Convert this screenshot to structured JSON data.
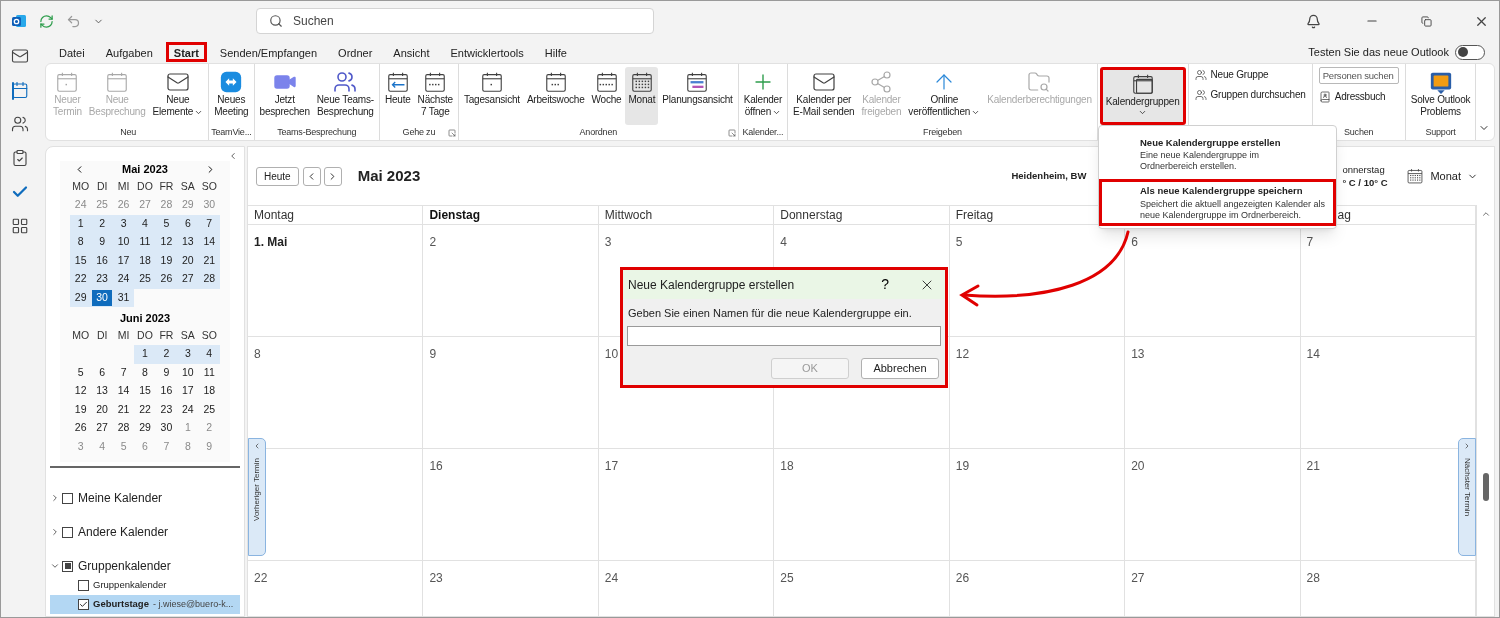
{
  "title_bar": {
    "search": {
      "placeholder": "Suchen"
    }
  },
  "rail": {
    "items": [
      {
        "selected": false
      },
      {
        "selected": true
      },
      {
        "selected": false
      },
      {
        "selected": false
      },
      {
        "selected": false
      },
      {
        "selected": false
      }
    ]
  },
  "menu": {
    "tabs": [
      {
        "label": "Datei",
        "selected": false
      },
      {
        "label": "Aufgaben",
        "selected": false
      },
      {
        "label": "Start",
        "selected": true,
        "highlighted": true
      },
      {
        "label": "Senden/Empfangen",
        "selected": false
      },
      {
        "label": "Ordner",
        "selected": false
      },
      {
        "label": "Ansicht",
        "selected": false
      },
      {
        "label": "Entwicklertools",
        "selected": false
      },
      {
        "label": "Hilfe",
        "selected": false
      }
    ],
    "toggle": {
      "label": "Testen Sie das neue Outlook",
      "on": false
    }
  },
  "ribbon": {
    "groups": [
      {
        "label": "Neu",
        "buttons": [
          {
            "kind": "large",
            "lines": [
              "Neuer",
              "Termin"
            ],
            "disabled": true
          },
          {
            "kind": "large",
            "lines": [
              "Neue",
              "Besprechung"
            ],
            "disabled": true
          },
          {
            "kind": "large",
            "lines": [
              "Neue",
              "Elemente"
            ],
            "caret": true
          }
        ]
      },
      {
        "label": "TeamVie...",
        "buttons": [
          {
            "kind": "large",
            "lines": [
              "Neues",
              "Meeting"
            ]
          }
        ]
      },
      {
        "label": "Teams-Besprechung",
        "buttons": [
          {
            "kind": "large",
            "lines": [
              "Jetzt",
              "besprechen"
            ]
          },
          {
            "kind": "large",
            "lines": [
              "Neue Teams-",
              "Besprechung"
            ]
          }
        ]
      },
      {
        "label": "Gehe zu",
        "launcher": true,
        "buttons": [
          {
            "kind": "large",
            "lines": [
              "Heute"
            ]
          },
          {
            "kind": "large",
            "lines": [
              "Nächste",
              "7 Tage"
            ]
          }
        ]
      },
      {
        "label": "Anordnen",
        "launcher": true,
        "buttons": [
          {
            "kind": "large",
            "lines": [
              "Tagesansicht"
            ],
            "selected": false
          },
          {
            "kind": "large",
            "lines": [
              "Arbeitswoche"
            ],
            "selected": false
          },
          {
            "kind": "large",
            "lines": [
              "Woche"
            ],
            "selected": false
          },
          {
            "kind": "large",
            "lines": [
              "Monat"
            ],
            "selected": true
          },
          {
            "kind": "large",
            "lines": [
              "Planungsansicht"
            ],
            "selected": false
          }
        ]
      },
      {
        "label": "Kalender...",
        "buttons": [
          {
            "kind": "large",
            "lines": [
              "Kalender",
              "öffnen"
            ],
            "caret": true
          }
        ]
      },
      {
        "label": "Freigeben",
        "buttons": [
          {
            "kind": "large",
            "lines": [
              "Kalender per",
              "E-Mail senden"
            ]
          },
          {
            "kind": "large",
            "lines": [
              "Kalender",
              "freigeben"
            ],
            "disabled": true
          },
          {
            "kind": "large",
            "lines": [
              "Online",
              "veröffentlichen"
            ],
            "caret": true
          },
          {
            "kind": "large",
            "lines": [
              "Kalenderberechtigungen"
            ],
            "disabled": true
          }
        ]
      },
      {
        "buttons": [
          {
            "kind": "large",
            "lines": [
              "Kalendergruppen"
            ],
            "selected": true,
            "caret": true,
            "highlighted": true
          }
        ]
      },
      {
        "buttons": [
          {
            "kind": "small",
            "lines": [
              "Neue Gruppe"
            ]
          },
          {
            "kind": "small",
            "lines": [
              "Gruppen durchsuchen"
            ]
          }
        ]
      },
      {
        "label": "Suchen",
        "buttons": [
          {
            "kind": "field",
            "placeholder": "Personen suchen"
          },
          {
            "kind": "small",
            "lines": [
              "Adressbuch"
            ]
          }
        ]
      },
      {
        "label": "Support",
        "buttons": [
          {
            "kind": "large",
            "lines": [
              "Solve Outlook",
              "Problems"
            ]
          }
        ]
      }
    ]
  },
  "sidebar": {
    "months": [
      {
        "title": "Mai 2023",
        "weekdays": [
          "MO",
          "DI",
          "MI",
          "DO",
          "FR",
          "SA",
          "SO"
        ],
        "weeks": [
          [
            {
              "day": "24",
              "muted": true,
              "in_view": false,
              "selected": false
            },
            {
              "day": "25",
              "muted": true,
              "in_view": false,
              "selected": false
            },
            {
              "day": "26",
              "muted": true,
              "in_view": false,
              "selected": false
            },
            {
              "day": "27",
              "muted": true,
              "in_view": false,
              "selected": false
            },
            {
              "day": "28",
              "muted": true,
              "in_view": false,
              "selected": false
            },
            {
              "day": "29",
              "muted": true,
              "in_view": false,
              "selected": false
            },
            {
              "day": "30",
              "muted": true,
              "in_view": false,
              "selected": false
            }
          ],
          [
            {
              "day": "1",
              "muted": false,
              "in_view": true,
              "selected": false
            },
            {
              "day": "2",
              "muted": false,
              "in_view": true,
              "selected": false
            },
            {
              "day": "3",
              "muted": false,
              "in_view": true,
              "selected": false
            },
            {
              "day": "4",
              "muted": false,
              "in_view": true,
              "selected": false
            },
            {
              "day": "5",
              "muted": false,
              "in_view": true,
              "selected": false
            },
            {
              "day": "6",
              "muted": false,
              "in_view": true,
              "selected": false
            },
            {
              "day": "7",
              "muted": false,
              "in_view": true,
              "selected": false
            }
          ],
          [
            {
              "day": "8",
              "muted": false,
              "in_view": true,
              "selected": false
            },
            {
              "day": "9",
              "muted": false,
              "in_view": true,
              "selected": false
            },
            {
              "day": "10",
              "muted": false,
              "in_view": true,
              "selected": false
            },
            {
              "day": "11",
              "muted": false,
              "in_view": true,
              "selected": false
            },
            {
              "day": "12",
              "muted": false,
              "in_view": true,
              "selected": false
            },
            {
              "day": "13",
              "muted": false,
              "in_view": true,
              "selected": false
            },
            {
              "day": "14",
              "muted": false,
              "in_view": true,
              "selected": false
            }
          ],
          [
            {
              "day": "15",
              "muted": false,
              "in_view": true,
              "selected": false
            },
            {
              "day": "16",
              "muted": false,
              "in_view": true,
              "selected": false
            },
            {
              "day": "17",
              "muted": false,
              "in_view": true,
              "selected": false
            },
            {
              "day": "18",
              "muted": false,
              "in_view": true,
              "selected": false
            },
            {
              "day": "19",
              "muted": false,
              "in_view": true,
              "selected": false
            },
            {
              "day": "20",
              "muted": false,
              "in_view": true,
              "selected": false
            },
            {
              "day": "21",
              "muted": false,
              "in_view": true,
              "selected": false
            }
          ],
          [
            {
              "day": "22",
              "muted": false,
              "in_view": true,
              "selected": false
            },
            {
              "day": "23",
              "muted": false,
              "in_view": true,
              "selected": false
            },
            {
              "day": "24",
              "muted": false,
              "in_view": true,
              "selected": false
            },
            {
              "day": "25",
              "muted": false,
              "in_view": true,
              "selected": false
            },
            {
              "day": "26",
              "muted": false,
              "in_view": true,
              "selected": false
            },
            {
              "day": "27",
              "muted": false,
              "in_view": true,
              "selected": false
            },
            {
              "day": "28",
              "muted": false,
              "in_view": true,
              "selected": false
            }
          ],
          [
            {
              "day": "29",
              "muted": false,
              "in_view": true,
              "selected": false
            },
            {
              "day": "30",
              "muted": false,
              "in_view": true,
              "selected": true
            },
            {
              "day": "31",
              "muted": false,
              "in_view": true,
              "selected": false
            }
          ]
        ]
      },
      {
        "title": "Juni 2023",
        "weekdays": [
          "MO",
          "DI",
          "MI",
          "DO",
          "FR",
          "SA",
          "SO"
        ],
        "weeks": [
          [
            {
              "day": "1",
              "muted": false,
              "in_view": true,
              "selected": false
            },
            {
              "day": "2",
              "muted": false,
              "in_view": true,
              "selected": false
            },
            {
              "day": "3",
              "muted": false,
              "in_view": true,
              "selected": false
            },
            {
              "day": "4",
              "muted": false,
              "in_view": true,
              "selected": false
            }
          ],
          [
            {
              "day": "5",
              "muted": false,
              "in_view": false,
              "selected": false
            },
            {
              "day": "6",
              "muted": false,
              "in_view": false,
              "selected": false
            },
            {
              "day": "7",
              "muted": false,
              "in_view": false,
              "selected": false
            },
            {
              "day": "8",
              "muted": false,
              "in_view": false,
              "selected": false
            },
            {
              "day": "9",
              "muted": false,
              "in_view": false,
              "selected": false
            },
            {
              "day": "10",
              "muted": false,
              "in_view": false,
              "selected": false
            },
            {
              "day": "11",
              "muted": false,
              "in_view": false,
              "selected": false
            }
          ],
          [
            {
              "day": "12",
              "muted": false,
              "in_view": false,
              "selected": false
            },
            {
              "day": "13",
              "muted": false,
              "in_view": false,
              "selected": false
            },
            {
              "day": "14",
              "muted": false,
              "in_view": false,
              "selected": false
            },
            {
              "day": "15",
              "muted": false,
              "in_view": false,
              "selected": false
            },
            {
              "day": "16",
              "muted": false,
              "in_view": false,
              "selected": false
            },
            {
              "day": "17",
              "muted": false,
              "in_view": false,
              "selected": false
            },
            {
              "day": "18",
              "muted": false,
              "in_view": false,
              "selected": false
            }
          ],
          [
            {
              "day": "19",
              "muted": false,
              "in_view": false,
              "selected": false
            },
            {
              "day": "20",
              "muted": false,
              "in_view": false,
              "selected": false
            },
            {
              "day": "21",
              "muted": false,
              "in_view": false,
              "selected": false
            },
            {
              "day": "22",
              "muted": false,
              "in_view": false,
              "selected": false
            },
            {
              "day": "23",
              "muted": false,
              "in_view": false,
              "selected": false
            },
            {
              "day": "24",
              "muted": false,
              "in_view": false,
              "selected": false
            },
            {
              "day": "25",
              "muted": false,
              "in_view": false,
              "selected": false
            }
          ],
          [
            {
              "day": "26",
              "muted": false,
              "in_view": false,
              "selected": false
            },
            {
              "day": "27",
              "muted": false,
              "in_view": false,
              "selected": false
            },
            {
              "day": "28",
              "muted": false,
              "in_view": false,
              "selected": false
            },
            {
              "day": "29",
              "muted": false,
              "in_view": false,
              "selected": false
            },
            {
              "day": "30",
              "muted": false,
              "in_view": false,
              "selected": false
            },
            {
              "day": "1",
              "muted": true,
              "in_view": false,
              "selected": false
            },
            {
              "day": "2",
              "muted": true,
              "in_view": false,
              "selected": false
            }
          ],
          [
            {
              "day": "3",
              "muted": true,
              "in_view": false,
              "selected": false
            },
            {
              "day": "4",
              "muted": true,
              "in_view": false,
              "selected": false
            },
            {
              "day": "5",
              "muted": true,
              "in_view": false,
              "selected": false
            },
            {
              "day": "6",
              "muted": true,
              "in_view": false,
              "selected": false
            },
            {
              "day": "7",
              "muted": true,
              "in_view": false,
              "selected": false
            },
            {
              "day": "8",
              "muted": true,
              "in_view": false,
              "selected": false
            },
            {
              "day": "9",
              "muted": true,
              "in_view": false,
              "selected": false
            }
          ]
        ]
      }
    ],
    "folders": [
      {
        "label": "Meine Kalender",
        "expanded": false,
        "checked": false
      },
      {
        "label": "Andere Kalender",
        "expanded": false,
        "checked": false
      },
      {
        "label": "Gruppenkalender",
        "expanded": true,
        "partial": true,
        "children": [
          {
            "label": "Gruppenkalender",
            "checked": false,
            "selected": false
          },
          {
            "label": "Geburtstage",
            "detail": "- j.wiese@buero-k...",
            "checked": true,
            "selected": true
          }
        ]
      }
    ]
  },
  "calendar": {
    "today_button": "Heute",
    "title": "Mai 2023",
    "location": "Heidenheim, BW",
    "weather": [
      "onnerstag",
      "° C / 10° C"
    ],
    "view": "Monat",
    "columns": [
      {
        "label": "Montag",
        "today": false
      },
      {
        "label": "Dienstag",
        "today": true
      },
      {
        "label": "Mittwoch",
        "today": false
      },
      {
        "label": "Donnerstag",
        "today": false
      },
      {
        "label": "Freitag",
        "today": false
      },
      null,
      {
        "label": "ag",
        "today": false
      }
    ],
    "weeks": [
      {
        "mon": {
          "date": "1. Mai",
          "month_start": true
        },
        "tue": {
          "date": "2",
          "month_start": false
        },
        "wed": {
          "date": "3",
          "month_start": false
        },
        "thu": {
          "date": "4",
          "month_start": false
        },
        "fri": {
          "date": "5",
          "month_start": false
        },
        "sat": {
          "date": "6",
          "month_start": false
        },
        "sun": {
          "date": "7",
          "month_start": false
        }
      },
      {
        "mon": {
          "date": "8",
          "month_start": false
        },
        "tue": {
          "date": "9",
          "month_start": false
        },
        "wed": {
          "date": "10",
          "month_start": false
        },
        "fri": {
          "date": "12",
          "month_start": false
        },
        "sat": {
          "date": "13",
          "month_start": false
        },
        "sun": {
          "date": "14",
          "month_start": false
        }
      },
      {
        "tue": {
          "date": "16",
          "month_start": false
        },
        "wed": {
          "date": "17",
          "month_start": false
        },
        "thu": {
          "date": "18",
          "month_start": false
        },
        "fri": {
          "date": "19",
          "month_start": false
        },
        "sat": {
          "date": "20",
          "month_start": false
        },
        "sun": {
          "date": "21",
          "month_start": false
        }
      },
      {
        "mon": {
          "date": "22",
          "month_start": false
        },
        "tue": {
          "date": "23",
          "month_start": false
        },
        "wed": {
          "date": "24",
          "month_start": false
        },
        "thu": {
          "date": "25",
          "month_start": false
        },
        "fri": {
          "date": "26",
          "month_start": false
        },
        "sat": {
          "date": "27",
          "month_start": false
        },
        "sun": {
          "date": "28",
          "month_start": false
        }
      }
    ],
    "prev_tab": "Vorheriger Termin",
    "next_tab": "Nächster Termin"
  },
  "dropdown": {
    "items": [
      {
        "title": "Neue Kalendergruppe erstellen",
        "description": "Eine neue Kalendergruppe im Ordnerbereich erstellen.",
        "highlighted": false
      },
      {
        "title": "Als neue Kalendergruppe speichern",
        "description": "Speichert die aktuell angezeigten Kalender als neue Kalendergruppe im Ordnerbereich.",
        "highlighted": true
      }
    ]
  },
  "dialog": {
    "title": "Neue Kalendergruppe erstellen",
    "help": "?",
    "prompt": "Geben Sie einen Namen für die neue Kalendergruppe ein.",
    "highlighted": true,
    "buttons": [
      {
        "label": "OK",
        "disabled": true
      },
      {
        "label": "Abbrechen",
        "disabled": false
      }
    ]
  }
}
